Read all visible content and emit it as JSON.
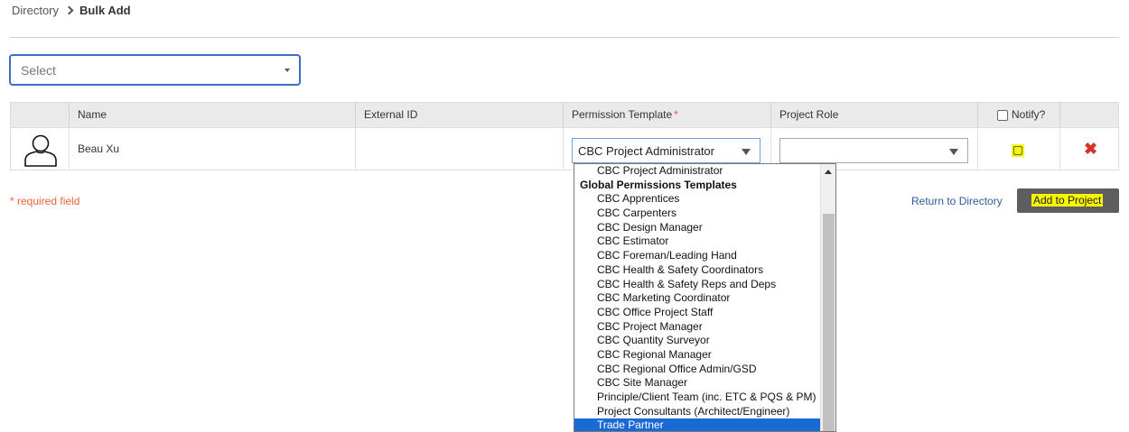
{
  "breadcrumb": {
    "parent": "Directory",
    "current": "Bulk Add"
  },
  "top_select": {
    "placeholder": "Select"
  },
  "table": {
    "headers": {
      "name": "Name",
      "external_id": "External ID",
      "permission_template": "Permission Template",
      "required_marker": "*",
      "project_role": "Project Role",
      "notify": "Notify?"
    },
    "rows": [
      {
        "name": "Beau Xu",
        "external_id": "",
        "permission_template": "CBC Project Administrator",
        "project_role": ""
      }
    ]
  },
  "required_note": "* required field",
  "actions": {
    "return_label": "Return to Directory",
    "add_label": "Add to Project"
  },
  "dropdown": {
    "items": [
      {
        "label": "CBC Project Administrator",
        "type": "option"
      },
      {
        "label": "Global Permissions Templates",
        "type": "group"
      },
      {
        "label": "CBC Apprentices",
        "type": "option"
      },
      {
        "label": "CBC Carpenters",
        "type": "option"
      },
      {
        "label": "CBC Design Manager",
        "type": "option"
      },
      {
        "label": "CBC Estimator",
        "type": "option"
      },
      {
        "label": "CBC Foreman/Leading Hand",
        "type": "option"
      },
      {
        "label": "CBC Health & Safety Coordinators",
        "type": "option"
      },
      {
        "label": "CBC Health & Safety Reps and Deps",
        "type": "option"
      },
      {
        "label": "CBC Marketing Coordinator",
        "type": "option"
      },
      {
        "label": "CBC Office Project Staff",
        "type": "option"
      },
      {
        "label": "CBC Project Manager",
        "type": "option"
      },
      {
        "label": "CBC Quantity Surveyor",
        "type": "option"
      },
      {
        "label": "CBC Regional Manager",
        "type": "option"
      },
      {
        "label": "CBC Regional Office Admin/GSD",
        "type": "option"
      },
      {
        "label": "CBC Site Manager",
        "type": "option"
      },
      {
        "label": "Principle/Client Team (inc. ETC & PQS & PM)",
        "type": "option"
      },
      {
        "label": "Project Consultants (Architect/Engineer)",
        "type": "option"
      },
      {
        "label": "Trade Partner",
        "type": "option",
        "highlighted": true
      }
    ]
  },
  "colors": {
    "accent_blue": "#3a6ec8",
    "highlight_yellow": "#f6f600",
    "delete_red": "#d9342b",
    "required_orange": "#e8663c",
    "selected_option": "#1a6ad6"
  },
  "icons": {
    "avatar": "user-outline-icon",
    "delete": "red-x-icon",
    "caret": "chevron-down-icon"
  }
}
